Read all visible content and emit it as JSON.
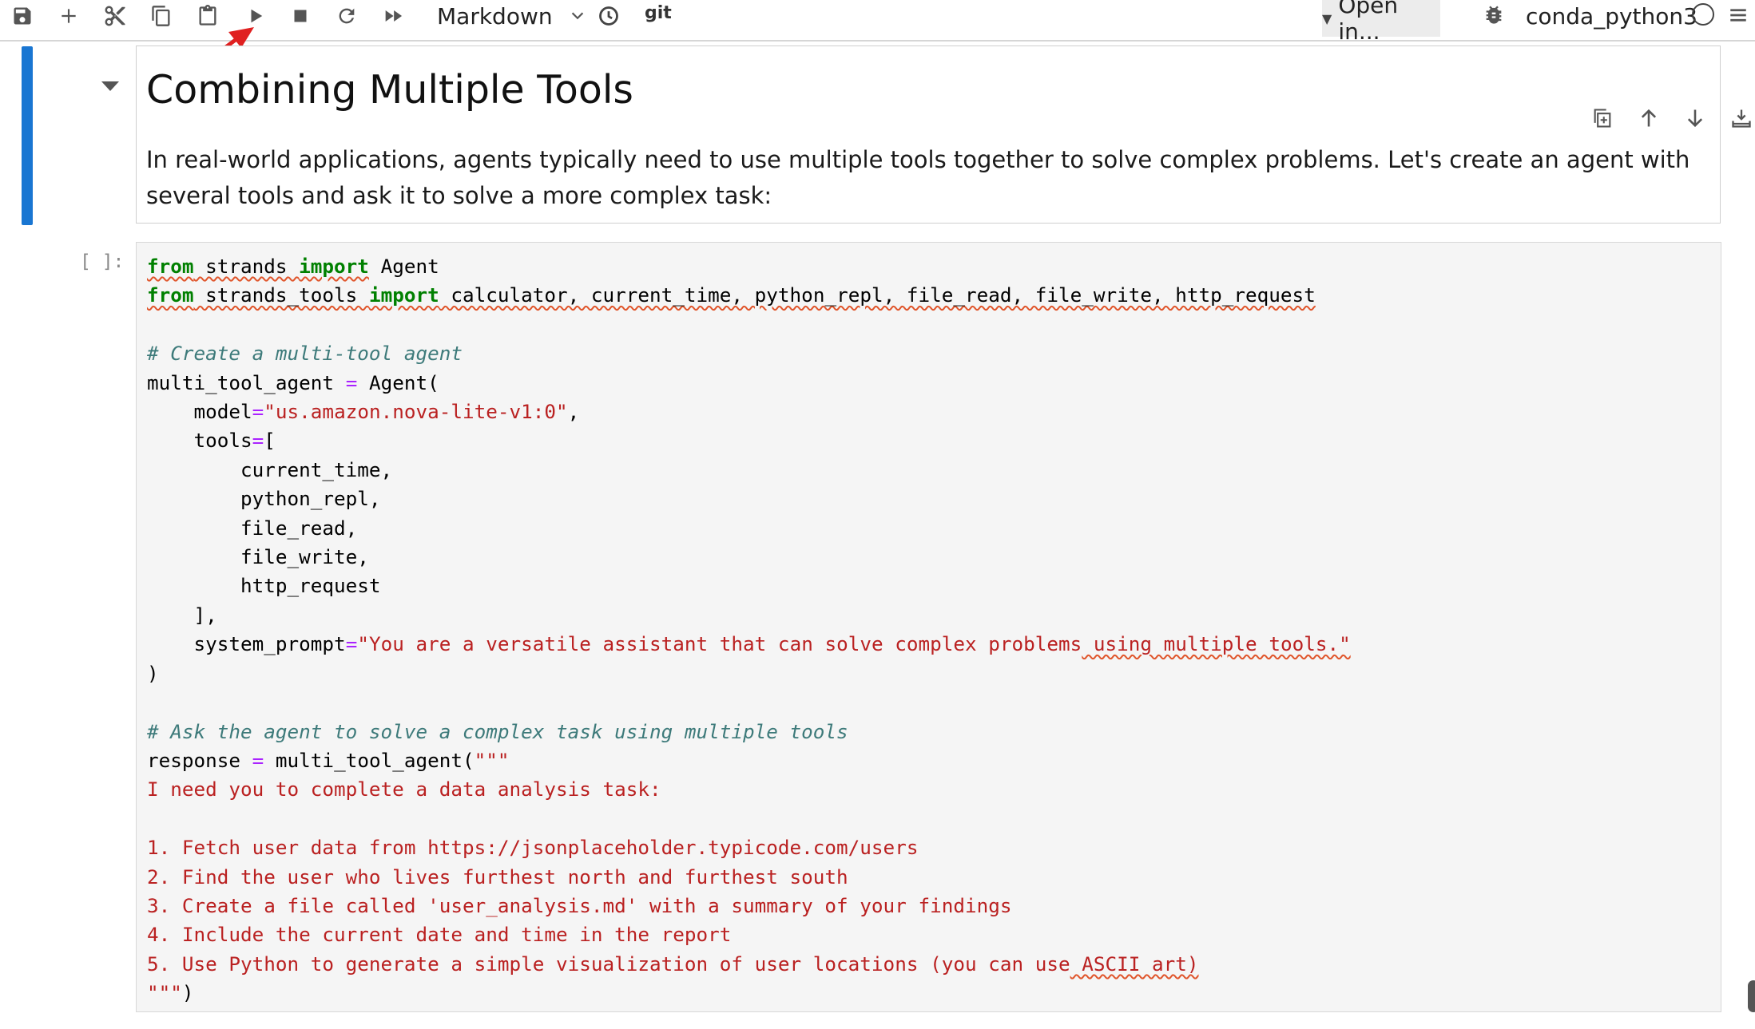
{
  "toolbar": {
    "icons": [
      "save-icon",
      "plus-icon",
      "cut-icon",
      "copy-icon",
      "paste-icon",
      "run-icon",
      "stop-icon",
      "restart-icon",
      "fast-forward-icon"
    ],
    "cell_type": "Markdown",
    "git_label": "git",
    "open_in_label": "Open in...",
    "kernel_name": "conda_python3"
  },
  "markdown_cell": {
    "title": "Combining Multiple Tools",
    "paragraph": "In real-world applications, agents typically need to use multiple tools together to solve complex problems. Let's create an agent with several tools and ask it to solve a more complex task:"
  },
  "code_cell": {
    "prompt": "[ ]:",
    "line_1_keyword_from": "from",
    "line_1_module": " strands ",
    "line_1_keyword_import": "import",
    "line_1_names": " Agent",
    "line_2_keyword_from": "from",
    "line_2_module": " strands_tools ",
    "line_2_keyword_import": "import",
    "line_2_names": " calculator, current_time, python_repl, file_read, file_write, http_request",
    "comment_1": "# Create a multi-tool agent",
    "agent_var": "multi_tool_agent ",
    "assign_op": "=",
    "agent_call": " Agent(",
    "model_key": "    model",
    "model_eq": "=",
    "model_value": "\"us.amazon.nova-lite-v1:0\"",
    "model_comma": ",",
    "tools_key": "    tools",
    "tools_eq": "=",
    "tools_open": "[",
    "tool_items": [
      "        current_time,",
      "        python_repl,",
      "        file_read,",
      "        file_write,",
      "        http_request"
    ],
    "tools_close": "    ],",
    "system_prompt_key": "    system_prompt",
    "system_prompt_eq": "=",
    "system_prompt_value_a": "\"You are a versatile assistant that can solve complex problems",
    "system_prompt_value_b": " using multiple tools.\"",
    "close_paren": ")",
    "comment_2": "# Ask the agent to solve a complex task using multiple tools",
    "response_var": "response ",
    "response_eq": "=",
    "response_call": " multi_tool_agent(",
    "response_str_open": "\"\"\"",
    "task_lines": [
      "I need you to complete a data analysis task:",
      "",
      "1. Fetch user data from https://jsonplaceholder.typicode.com/users",
      "2. Find the user who lives furthest north and furthest south",
      "3. Create a file called 'user_analysis.md' with a summary of your findings",
      "4. Include the current date and time in the report"
    ],
    "task_line_5a": "5. Use Python to generate a simple visualization of user locations (you can use",
    "task_line_5b": " ASCII art)",
    "response_str_close": "\"\"\"",
    "final_paren": ")"
  },
  "colors": {
    "active_cell_bar": "#1976d2",
    "keyword": "#008000",
    "string": "#ba2121",
    "comment": "#3d7a7a",
    "operator": "#aa22ff",
    "annotation_arrow": "#e02020"
  }
}
